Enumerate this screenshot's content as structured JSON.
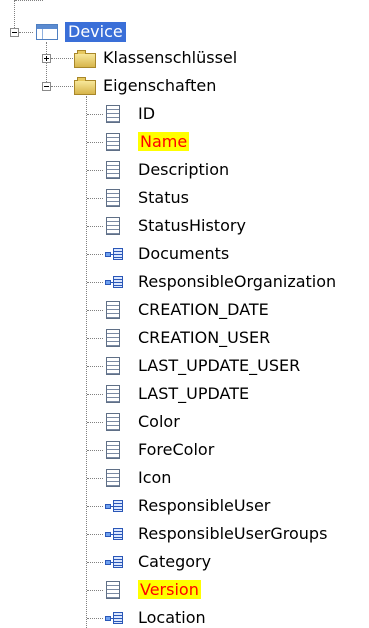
{
  "root": {
    "label": "Device",
    "icon": "table-icon",
    "expanded": true
  },
  "groups": [
    {
      "label": "Klassenschlüssel",
      "icon": "folder-icon",
      "expanded": false
    },
    {
      "label": "Eigenschaften",
      "icon": "folder-icon",
      "expanded": true
    }
  ],
  "properties": [
    {
      "label": "ID",
      "icon": "property-icon",
      "highlighted": false
    },
    {
      "label": "Name",
      "icon": "property-icon",
      "highlighted": true
    },
    {
      "label": "Description",
      "icon": "property-icon",
      "highlighted": false
    },
    {
      "label": "Status",
      "icon": "property-icon",
      "highlighted": false
    },
    {
      "label": "StatusHistory",
      "icon": "property-icon",
      "highlighted": false
    },
    {
      "label": "Documents",
      "icon": "navigation-icon",
      "highlighted": false
    },
    {
      "label": "ResponsibleOrganization",
      "icon": "navigation-icon",
      "highlighted": false
    },
    {
      "label": "CREATION_DATE",
      "icon": "property-icon",
      "highlighted": false
    },
    {
      "label": "CREATION_USER",
      "icon": "property-icon",
      "highlighted": false
    },
    {
      "label": "LAST_UPDATE_USER",
      "icon": "property-icon",
      "highlighted": false
    },
    {
      "label": "LAST_UPDATE",
      "icon": "property-icon",
      "highlighted": false
    },
    {
      "label": "Color",
      "icon": "property-icon",
      "highlighted": false
    },
    {
      "label": "ForeColor",
      "icon": "property-icon",
      "highlighted": false
    },
    {
      "label": "Icon",
      "icon": "property-icon",
      "highlighted": false
    },
    {
      "label": "ResponsibleUser",
      "icon": "navigation-icon",
      "highlighted": false
    },
    {
      "label": "ResponsibleUserGroups",
      "icon": "navigation-icon",
      "highlighted": false
    },
    {
      "label": "Category",
      "icon": "navigation-icon",
      "highlighted": false
    },
    {
      "label": "Version",
      "icon": "property-icon",
      "highlighted": true
    },
    {
      "label": "Location",
      "icon": "navigation-icon",
      "highlighted": false
    }
  ],
  "colors": {
    "selection": "#3a6fd8",
    "highlight_bg": "#ffff00",
    "highlight_text": "#ff0000"
  }
}
